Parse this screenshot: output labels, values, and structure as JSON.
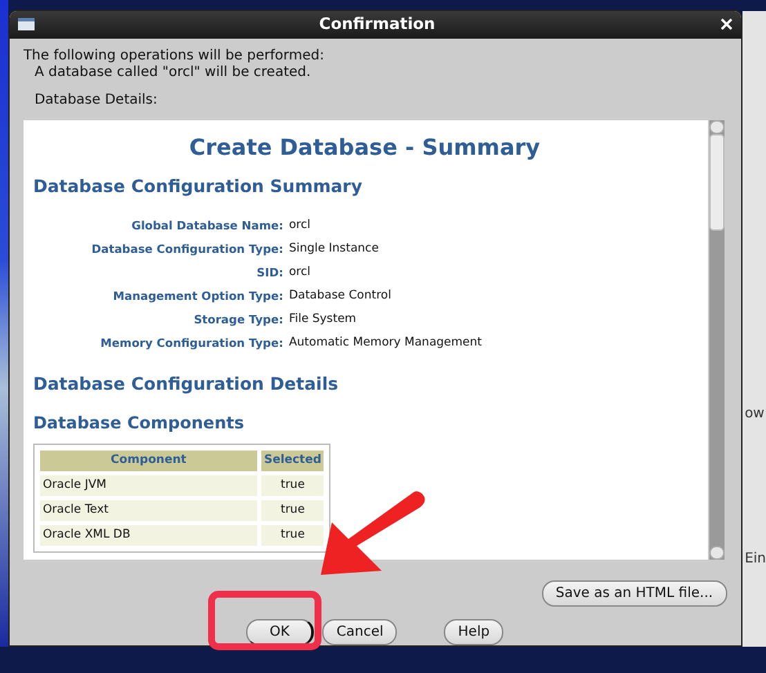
{
  "background": {
    "right_edge_texts": [
      "ow",
      "Ein"
    ]
  },
  "window": {
    "title": "Confirmation"
  },
  "intro": {
    "text": "The following operations will be performed:",
    "operation": "A database called \"orcl\" will be created.",
    "details_label": "Database Details:"
  },
  "summary": {
    "title": "Create Database - Summary",
    "configuration_summary": {
      "heading": "Database Configuration Summary",
      "fields": [
        {
          "label": "Global Database Name:",
          "value": "orcl"
        },
        {
          "label": "Database Configuration Type:",
          "value": "Single Instance"
        },
        {
          "label": "SID:",
          "value": "orcl"
        },
        {
          "label": "Management Option Type:",
          "value": "Database Control"
        },
        {
          "label": "Storage Type:",
          "value": "File System"
        },
        {
          "label": "Memory Configuration Type:",
          "value": "Automatic Memory Management"
        }
      ]
    },
    "configuration_details": {
      "heading": "Database Configuration Details"
    },
    "components": {
      "heading": "Database Components",
      "columns": [
        "Component",
        "Selected"
      ],
      "rows": [
        [
          "Oracle JVM",
          "true"
        ],
        [
          "Oracle Text",
          "true"
        ],
        [
          "Oracle XML DB",
          "true"
        ]
      ]
    }
  },
  "buttons": [
    {
      "label": "Save as an HTML file...",
      "kind": "side",
      "focused": false
    },
    {
      "label": "OK",
      "kind": "main",
      "focused": true
    },
    {
      "label": "Cancel",
      "kind": "main",
      "focused": false
    },
    {
      "label": "Help",
      "kind": "help",
      "focused": false
    }
  ]
}
